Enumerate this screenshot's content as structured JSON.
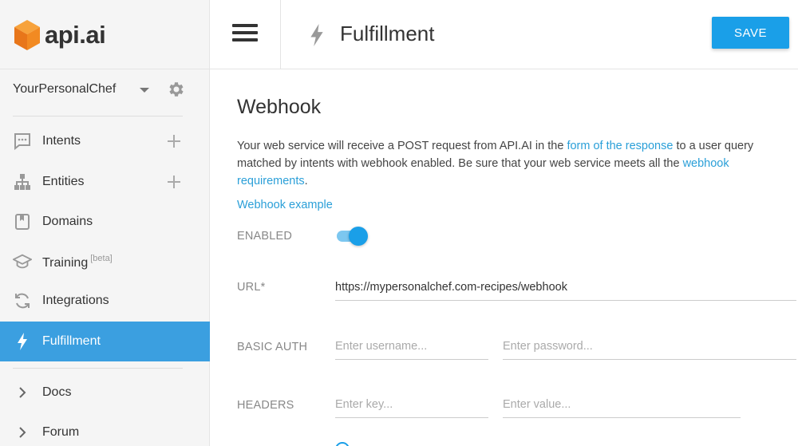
{
  "brand": {
    "logo_text": "api.ai",
    "accent": "#1a9fe8",
    "active_bg": "#3b9fe0"
  },
  "agent": {
    "name": "YourPersonalChef"
  },
  "sidebar": {
    "items": [
      {
        "label": "Intents",
        "icon": "chat-bubble-icon"
      },
      {
        "label": "Entities",
        "icon": "hierarchy-icon"
      },
      {
        "label": "Domains",
        "icon": "book-icon"
      },
      {
        "label": "Training",
        "badge": "[beta]",
        "icon": "graduation-cap-icon"
      },
      {
        "label": "Integrations",
        "icon": "sync-icon"
      },
      {
        "label": "Fulfillment",
        "icon": "bolt-icon"
      }
    ],
    "links": [
      {
        "label": "Docs",
        "icon": "chevron-right-icon"
      },
      {
        "label": "Forum",
        "icon": "chevron-right-icon"
      }
    ]
  },
  "header": {
    "title": "Fulfillment",
    "save_label": "SAVE"
  },
  "webhook": {
    "title": "Webhook",
    "desc_1": "Your web service will receive a POST request from API.AI in the ",
    "desc_link_1": "form of the response",
    "desc_2": " to a user query matched by intents with webhook enabled. Be sure that your web service meets all the ",
    "desc_link_2": "webhook requirements",
    "desc_3": ".",
    "example_link": "Webhook example",
    "enabled_label": "ENABLED",
    "enabled": true,
    "url_label": "URL*",
    "url_value": "https://mypersonalchef.com-recipes/webhook",
    "basic_auth_label": "BASIC AUTH",
    "username_placeholder": "Enter username...",
    "password_placeholder": "Enter password...",
    "headers_label": "HEADERS",
    "key_placeholder": "Enter key...",
    "value_placeholder": "Enter value..."
  }
}
